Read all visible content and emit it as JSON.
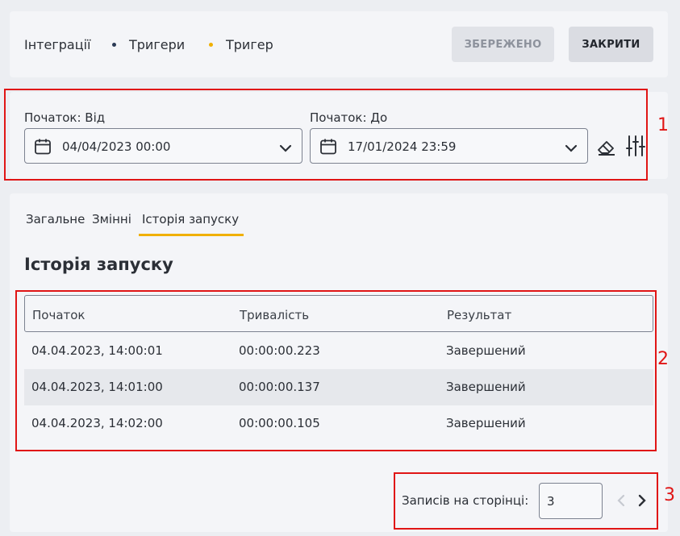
{
  "breadcrumb": {
    "items": [
      "Інтеграції",
      "Тригери",
      "Тригер"
    ],
    "dot_colors": [
      "#2b3a55",
      "#f0b000"
    ]
  },
  "toolbar": {
    "saved_label": "ЗБЕРЕЖЕНО",
    "close_label": "ЗАКРИТИ"
  },
  "filters": {
    "from_label": "Початок: Від",
    "from_value": "04/04/2023 00:00",
    "to_label": "Початок: До",
    "to_value": "17/01/2024 23:59",
    "icons": [
      "calendar-icon",
      "chevron-down-icon",
      "eraser-icon",
      "sliders-icon"
    ]
  },
  "tabs": [
    {
      "label": "Загальне",
      "active": false
    },
    {
      "label": "Змінні",
      "active": false
    },
    {
      "label": "Історія запуску",
      "active": true
    }
  ],
  "section_title": "Історія запуску",
  "table": {
    "columns": [
      "Початок",
      "Тривалість",
      "Результат"
    ],
    "rows": [
      [
        "04.04.2023, 14:00:01",
        "00:00:00.223",
        "Завершений"
      ],
      [
        "04.04.2023, 14:01:00",
        "00:00:00.137",
        "Завершений"
      ],
      [
        "04.04.2023, 14:02:00",
        "00:00:00.105",
        "Завершений"
      ]
    ]
  },
  "pagination": {
    "per_page_label": "Записів на сторінці:",
    "per_page_value": "3",
    "icons": [
      "chevron-left-icon",
      "chevron-right-icon"
    ]
  },
  "annotations": [
    "1",
    "2",
    "3"
  ],
  "colors": {
    "accent": "#f0b000",
    "annotation": "#e01515",
    "background": "#eceef2"
  }
}
